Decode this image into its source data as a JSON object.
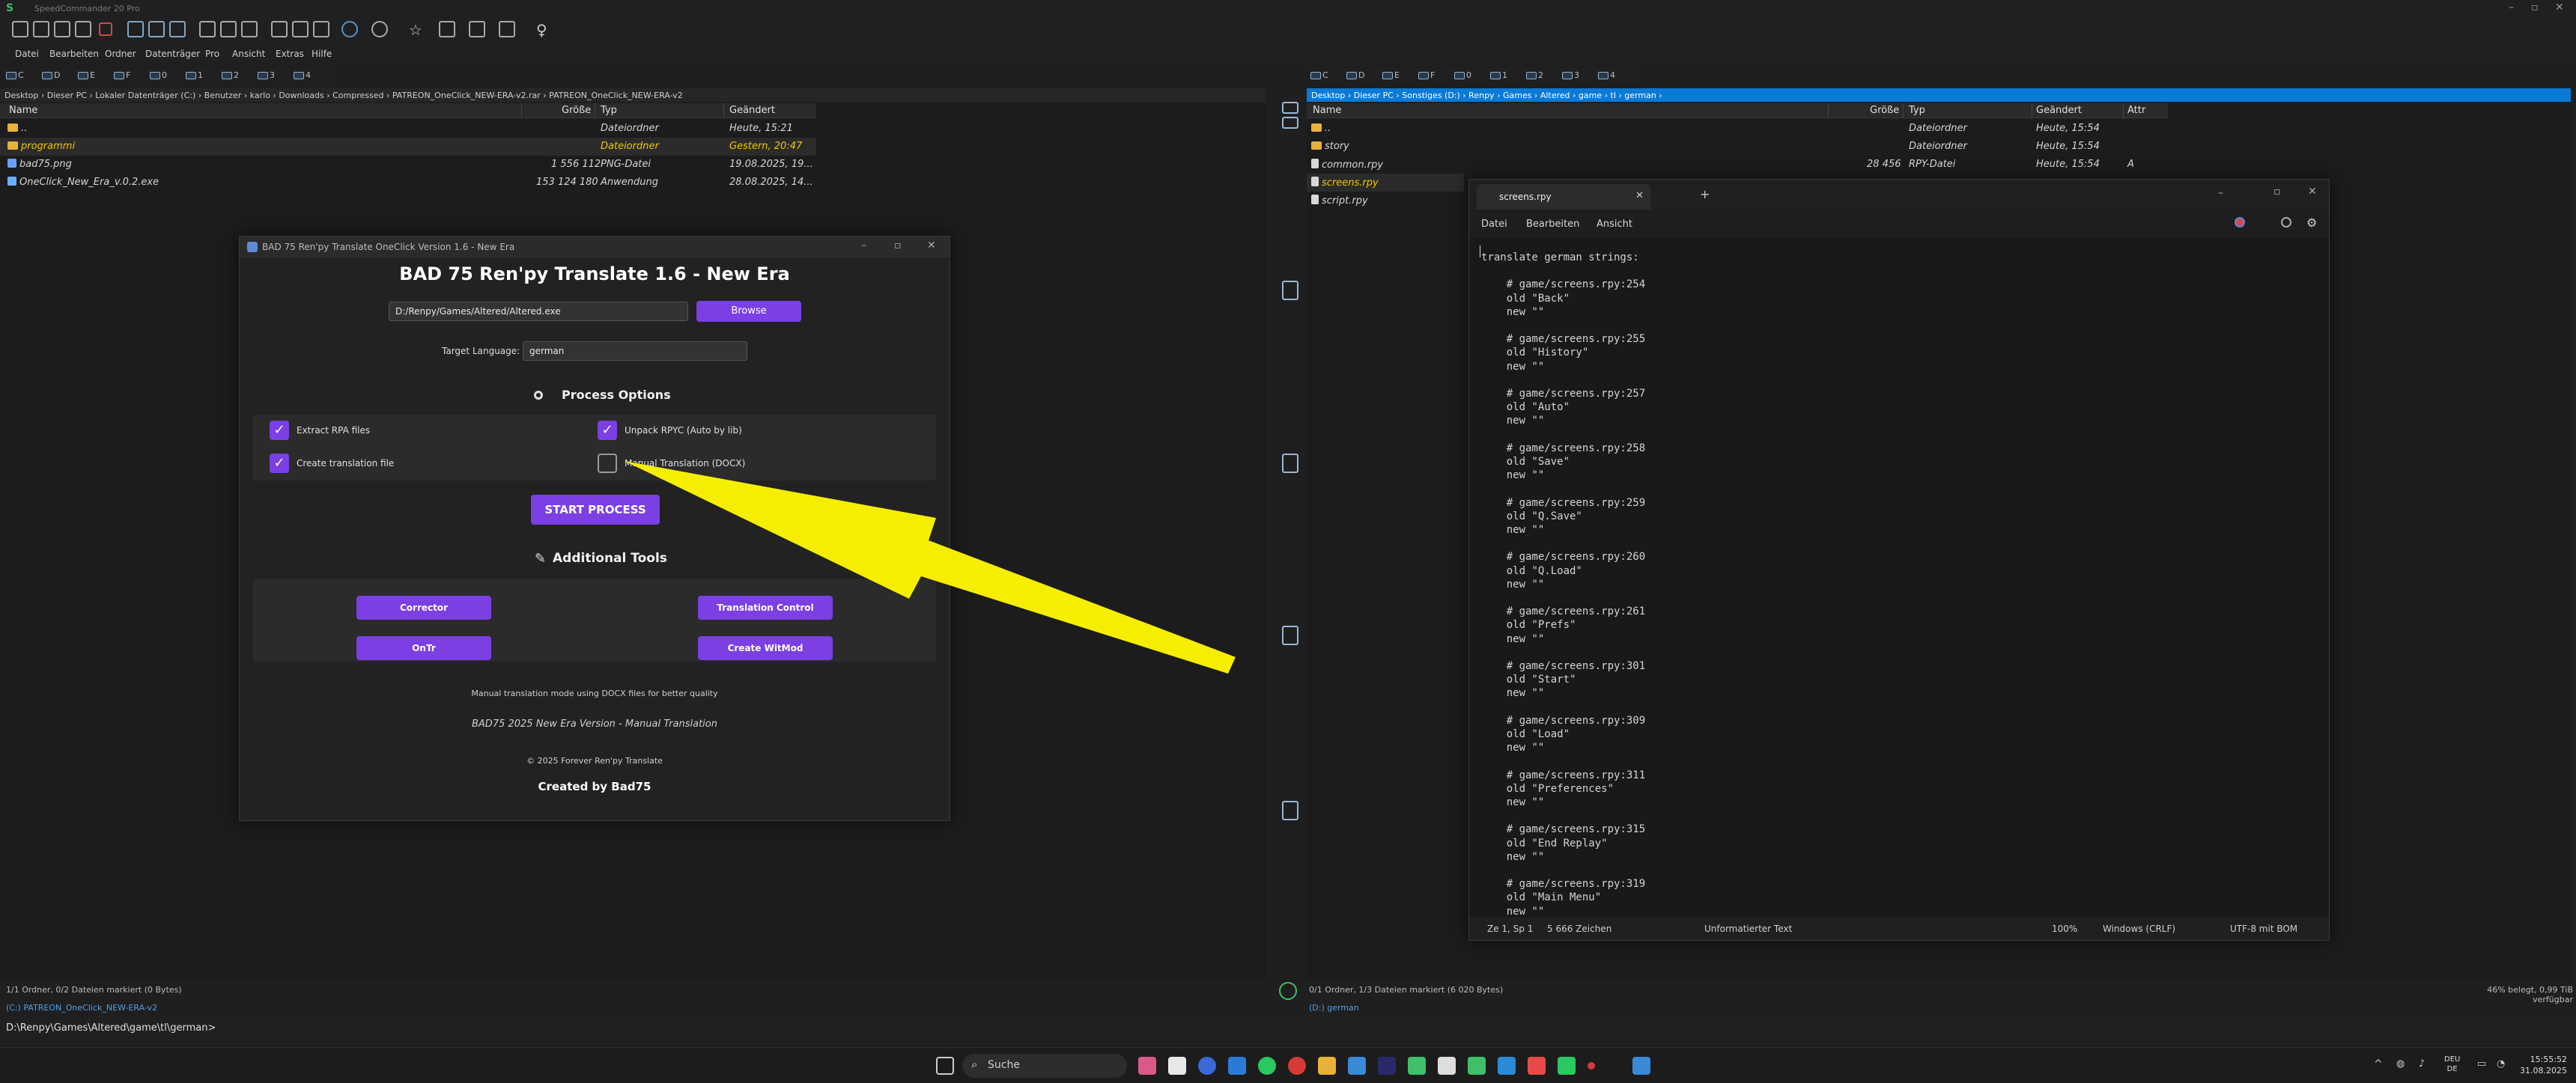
{
  "window": {
    "title": "SpeedCommander 20 Pro"
  },
  "menu": [
    "Datei",
    "Bearbeiten",
    "Ordner",
    "Datenträger",
    "Pro",
    "Ansicht",
    "Extras",
    "Hilfe"
  ],
  "left": {
    "path": "Desktop › Dieser PC › Lokaler Datenträger (C:) › Benutzer › karlo › Downloads › Compressed › PATREON_OneClick_NEW-ERA-v2.rar › PATREON_OneClick_NEW-ERA-v2",
    "columns": {
      "name": "Name",
      "size": "Größe",
      "type": "Typ",
      "date": "Geändert"
    },
    "rows": [
      {
        "name": "..",
        "size": "",
        "type": "Dateiordner",
        "date": "Heute, 15:21",
        "icon": "folder"
      },
      {
        "name": "programmi",
        "size": "",
        "type": "Dateiordner",
        "date": "Gestern, 20:47",
        "icon": "folder",
        "highlight": true
      },
      {
        "name": "bad75.png",
        "size": "1 556 112",
        "type": "PNG-Datei",
        "date": "19.08.2025, 19...",
        "icon": "png"
      },
      {
        "name": "OneClick_New_Era_v.0.2.exe",
        "size": "153 124 180",
        "type": "Anwendung",
        "date": "28.08.2025, 14...",
        "icon": "exe"
      }
    ],
    "status": "1/1 Ordner, 0/2 Dateien markiert (0 Bytes)",
    "tab": "(C:) PATREON_OneClick_NEW-ERA-v2"
  },
  "right": {
    "path": "Desktop › Dieser PC › Sonstiges (D:) › Renpy › Games › Altered › game › tl › german ›",
    "columns": {
      "name": "Name",
      "size": "Größe",
      "type": "Typ",
      "date": "Geändert",
      "attr": "Attr"
    },
    "rows": [
      {
        "name": "..",
        "size": "",
        "type": "Dateiordner",
        "date": "Heute, 15:54",
        "attr": "",
        "icon": "folder"
      },
      {
        "name": "story",
        "size": "",
        "type": "Dateiordner",
        "date": "Heute, 15:54",
        "attr": "",
        "icon": "folder"
      },
      {
        "name": "common.rpy",
        "size": "28 456",
        "type": "RPY-Datei",
        "date": "Heute, 15:54",
        "attr": "A",
        "icon": "file"
      },
      {
        "name": "screens.rpy",
        "size": "",
        "type": "",
        "date": "",
        "attr": "",
        "icon": "file",
        "highlight": true
      },
      {
        "name": "script.rpy",
        "size": "",
        "type": "",
        "date": "",
        "attr": "",
        "icon": "file"
      }
    ],
    "status": "0/1 Ordner, 1/3 Dateien markiert (6 020 Bytes)",
    "disk": "46% belegt, 0,99 TiB verfügbar",
    "tab": "(D:) german"
  },
  "dialog": {
    "caption": "BAD 75 Ren'py Translate OneClick Version 1.6 - New Era",
    "title": "BAD 75 Ren'py Translate 1.6 - New Era",
    "exe_path": "D:/Renpy/Games/Altered/Altered.exe",
    "browse": "Browse",
    "lang_label": "Target Language:",
    "lang_value": "german",
    "process_options": "Process Options",
    "opt_extract": "Extract RPA files",
    "opt_unpack": "Unpack RPYC (Auto by lib)",
    "opt_create": "Create translation file",
    "opt_manual": "Manual Translation (DOCX)",
    "start": "START PROCESS",
    "additional": "Additional Tools",
    "corrector": "Corrector",
    "translation_control": "Translation Control",
    "ontr": "OnTr",
    "create_witmod": "Create WitMod",
    "note": "Manual translation mode using DOCX files for better quality",
    "version": "BAD75 2025 New Era Version - Manual Translation",
    "copyright": "© 2025 Forever Ren'py Translate",
    "created": "Created by Bad75"
  },
  "notepad": {
    "tab": "screens.rpy",
    "menu": [
      "Datei",
      "Bearbeiten",
      "Ansicht"
    ],
    "lines": [
      "translate german strings:",
      "",
      "    # game/screens.rpy:254",
      "    old \"Back\"",
      "    new \"\"",
      "",
      "    # game/screens.rpy:255",
      "    old \"History\"",
      "    new \"\"",
      "",
      "    # game/screens.rpy:257",
      "    old \"Auto\"",
      "    new \"\"",
      "",
      "    # game/screens.rpy:258",
      "    old \"Save\"",
      "    new \"\"",
      "",
      "    # game/screens.rpy:259",
      "    old \"Q.Save\"",
      "    new \"\"",
      "",
      "    # game/screens.rpy:260",
      "    old \"Q.Load\"",
      "    new \"\"",
      "",
      "    # game/screens.rpy:261",
      "    old \"Prefs\"",
      "    new \"\"",
      "",
      "    # game/screens.rpy:301",
      "    old \"Start\"",
      "    new \"\"",
      "",
      "    # game/screens.rpy:309",
      "    old \"Load\"",
      "    new \"\"",
      "",
      "    # game/screens.rpy:311",
      "    old \"Preferences\"",
      "    new \"\"",
      "",
      "    # game/screens.rpy:315",
      "    old \"End Replay\"",
      "    new \"\"",
      "",
      "    # game/screens.rpy:319",
      "    old \"Main Menu\"",
      "    new \"\""
    ],
    "status": {
      "pos": "Ze 1, Sp 1",
      "chars": "5 666 Zeichen",
      "format": "Unformatierter Text",
      "zoom": "100%",
      "eol": "Windows (CRLF)",
      "enc": "UTF-8 mit BOM"
    }
  },
  "command_line": "D:\\Renpy\\Games\\Altered\\game\\tl\\german>",
  "taskbar": {
    "search": "Suche",
    "lang1": "DEU",
    "lang2": "DE",
    "time": "15:55:52",
    "date": "31.08.2025"
  }
}
